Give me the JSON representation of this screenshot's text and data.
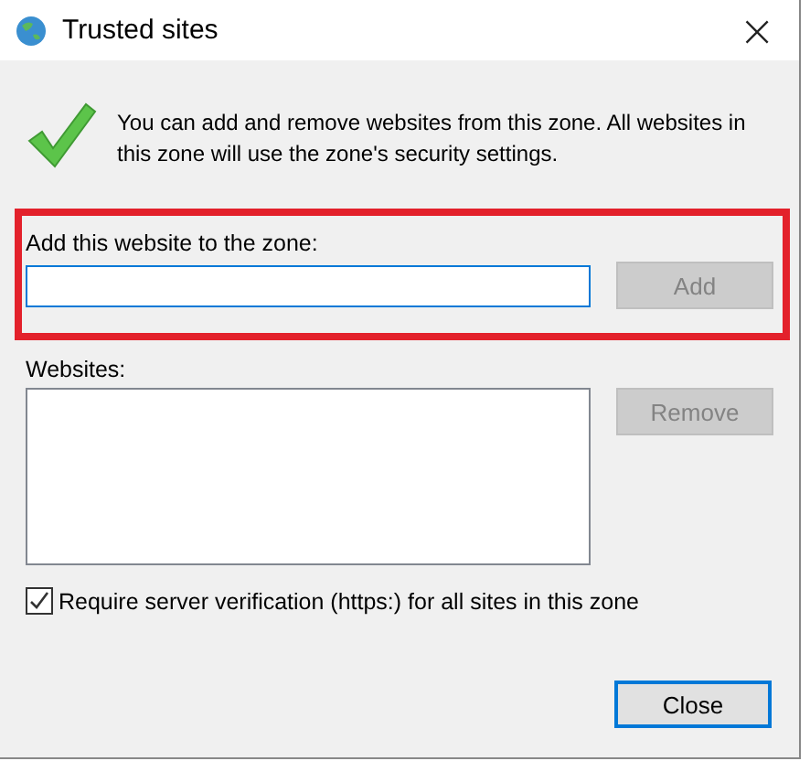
{
  "window": {
    "title": "Trusted sites",
    "close": "×"
  },
  "intro": "You can add and remove websites from this zone. All websites in this zone will use the zone's security settings.",
  "add_section": {
    "label": "Add this website to the zone:",
    "focused": true,
    "button": {
      "label": "Add",
      "disabled": true
    },
    "highlighted": true
  },
  "websites": {
    "label": "Websites:",
    "button": {
      "label": "Remove",
      "disabled": true
    }
  },
  "require_https": {
    "label": "Require server verification (https:) for all sites in this zone",
    "checked": true
  },
  "close_button": {
    "label": "Close",
    "default": true
  }
}
